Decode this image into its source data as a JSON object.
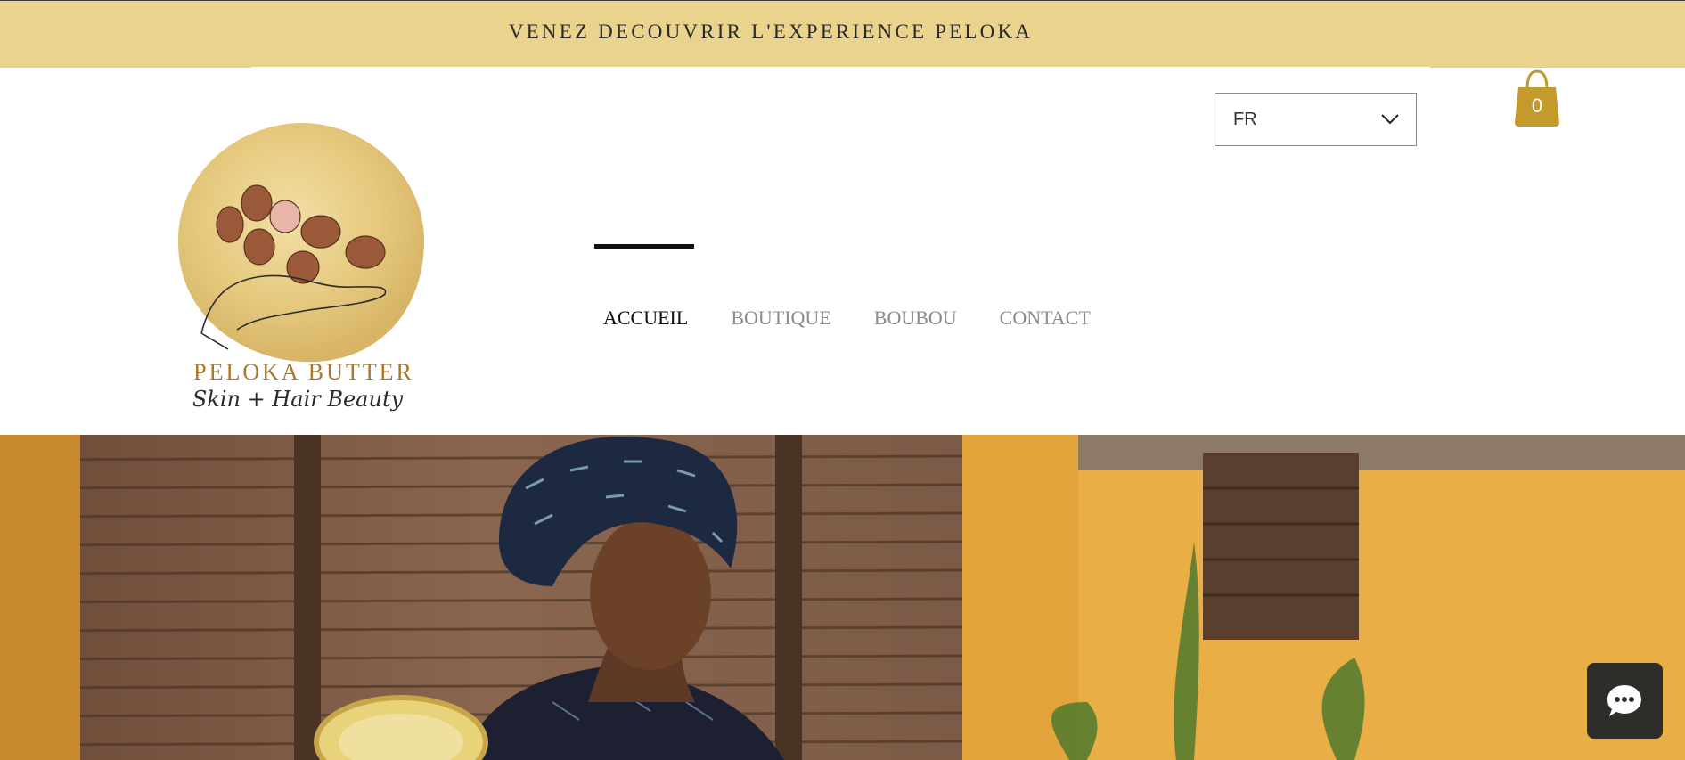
{
  "announcement": {
    "text": "VENEZ DECOUVRIR L'EXPERIENCE PELOKA"
  },
  "logo": {
    "brand": "PELOKA BUTTER",
    "tagline": "Skin + Hair Beauty"
  },
  "language": {
    "selected": "FR"
  },
  "cart": {
    "count": "0",
    "icon": "shopping-bag-icon"
  },
  "nav": {
    "items": [
      {
        "label": "ACCUEIL",
        "active": true
      },
      {
        "label": "BOUTIQUE",
        "active": false
      },
      {
        "label": "BOUBOU",
        "active": false
      },
      {
        "label": "CONTACT",
        "active": false
      }
    ]
  },
  "chat": {
    "icon": "chat-bubble-icon"
  },
  "colors": {
    "banner": "#ead38c",
    "gold": "#c49a2c",
    "dark": "#2e2d2a"
  }
}
